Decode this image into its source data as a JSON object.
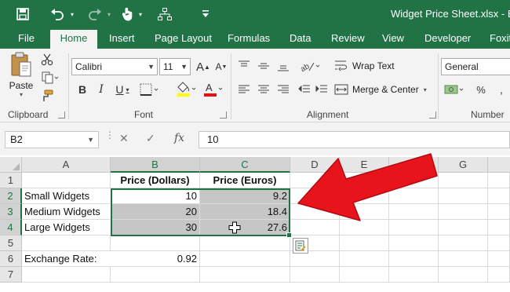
{
  "window": {
    "title": "Widget Price Sheet.xlsx - Exce"
  },
  "quick_access": [
    "save-icon",
    "undo-icon",
    "redo-icon",
    "touch-mode-icon",
    "org-chart-icon",
    "customize-chevron-icon"
  ],
  "tabs": [
    {
      "label": "File"
    },
    {
      "label": "Home",
      "active": true
    },
    {
      "label": "Insert"
    },
    {
      "label": "Page Layout"
    },
    {
      "label": "Formulas"
    },
    {
      "label": "Data"
    },
    {
      "label": "Review"
    },
    {
      "label": "View"
    },
    {
      "label": "Developer"
    },
    {
      "label": "Foxit"
    }
  ],
  "ribbon": {
    "clipboard": {
      "label": "Clipboard",
      "paste_label": "Paste"
    },
    "font": {
      "label": "Font",
      "font_name": "Calibri",
      "font_size": "11"
    },
    "alignment": {
      "label": "Alignment",
      "wrap_text": "Wrap Text",
      "merge_center": "Merge & Center"
    },
    "number": {
      "label": "Number",
      "format": "General"
    }
  },
  "formula_bar": {
    "name_box": "B2",
    "fx": "fx",
    "content": "10"
  },
  "grid": {
    "columns": [
      "A",
      "B",
      "C",
      "D",
      "E",
      "F",
      "G"
    ],
    "selected_columns": [
      "B",
      "C"
    ],
    "rows": [
      "1",
      "2",
      "3",
      "4",
      "5",
      "6",
      "7"
    ],
    "selected_rows": [
      "2",
      "3",
      "4"
    ],
    "cells": {
      "B1": "Price (Dollars)",
      "C1": "Price (Euros)",
      "A2": "Small Widgets",
      "B2": "10",
      "C2": "9.2",
      "A3": "Medium Widgets",
      "B3": "20",
      "C3": "18.4",
      "A4": "Large Widgets",
      "B4": "30",
      "C4": "27.6",
      "A6": "Exchange Rate:",
      "B6": "0.92"
    },
    "selection": "B2:C4"
  },
  "colors": {
    "excel_green": "#217346",
    "annotation_arrow": "#e8141b",
    "selection_fill": "#c6c6c6"
  }
}
